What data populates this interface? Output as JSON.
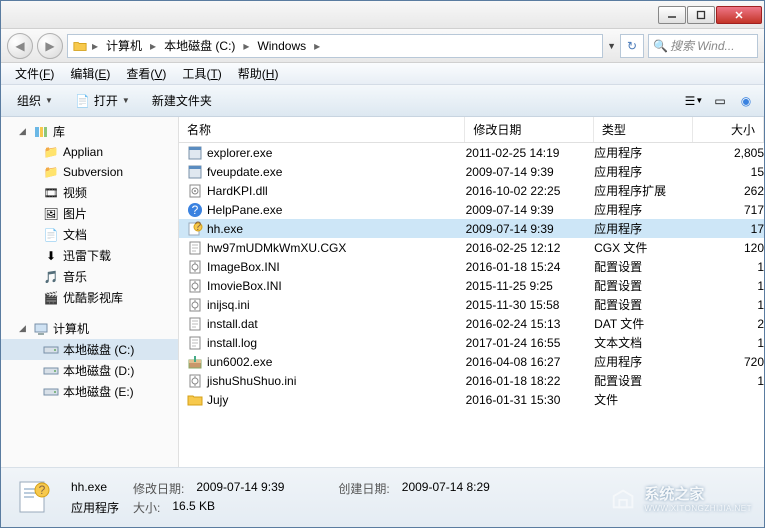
{
  "titlebar": {
    "minimize": "—",
    "maximize": "▢",
    "close": "✕"
  },
  "nav": {
    "breadcrumb": [
      {
        "icon": "computer",
        "label": "计算机"
      },
      {
        "icon": null,
        "label": "本地磁盘 (C:)"
      },
      {
        "icon": null,
        "label": "Windows"
      }
    ],
    "search_placeholder": "搜索 Wind..."
  },
  "menu": [
    {
      "label": "文件",
      "key": "F"
    },
    {
      "label": "编辑",
      "key": "E"
    },
    {
      "label": "查看",
      "key": "V"
    },
    {
      "label": "工具",
      "key": "T"
    },
    {
      "label": "帮助",
      "key": "H"
    }
  ],
  "toolbar": {
    "organize": "组织",
    "open": "打开",
    "newfolder": "新建文件夹"
  },
  "sidebar": {
    "library": "库",
    "library_items": [
      "Applian",
      "Subversion",
      "视频",
      "图片",
      "文档",
      "迅雷下载",
      "音乐",
      "优酷影视库"
    ],
    "computer": "计算机",
    "drives": [
      "本地磁盘 (C:)",
      "本地磁盘 (D:)",
      "本地磁盘 (E:)"
    ]
  },
  "columns": {
    "name": "名称",
    "date": "修改日期",
    "type": "类型",
    "size": "大小"
  },
  "files": [
    {
      "icon": "app",
      "name": "explorer.exe",
      "date": "2011-02-25 14:19",
      "type": "应用程序",
      "size": "2,805",
      "sel": false
    },
    {
      "icon": "app",
      "name": "fveupdate.exe",
      "date": "2009-07-14 9:39",
      "type": "应用程序",
      "size": "15",
      "sel": false
    },
    {
      "icon": "dll",
      "name": "HardKPI.dll",
      "date": "2016-10-02 22:25",
      "type": "应用程序扩展",
      "size": "262",
      "sel": false
    },
    {
      "icon": "helpexe",
      "name": "HelpPane.exe",
      "date": "2009-07-14 9:39",
      "type": "应用程序",
      "size": "717",
      "sel": false
    },
    {
      "icon": "hh",
      "name": "hh.exe",
      "date": "2009-07-14 9:39",
      "type": "应用程序",
      "size": "17",
      "sel": true
    },
    {
      "icon": "txt",
      "name": "hw97mUDMkWmXU.CGX",
      "date": "2016-02-25 12:12",
      "type": "CGX 文件",
      "size": "120",
      "sel": false
    },
    {
      "icon": "ini",
      "name": "ImageBox.INI",
      "date": "2016-01-18 15:24",
      "type": "配置设置",
      "size": "1",
      "sel": false
    },
    {
      "icon": "ini",
      "name": "ImovieBox.INI",
      "date": "2015-11-25 9:25",
      "type": "配置设置",
      "size": "1",
      "sel": false
    },
    {
      "icon": "ini",
      "name": "inijsq.ini",
      "date": "2015-11-30 15:58",
      "type": "配置设置",
      "size": "1",
      "sel": false
    },
    {
      "icon": "txt",
      "name": "install.dat",
      "date": "2016-02-24 15:13",
      "type": "DAT 文件",
      "size": "2",
      "sel": false
    },
    {
      "icon": "txt",
      "name": "install.log",
      "date": "2017-01-24 16:55",
      "type": "文本文档",
      "size": "1",
      "sel": false
    },
    {
      "icon": "inst",
      "name": "iun6002.exe",
      "date": "2016-04-08 16:27",
      "type": "应用程序",
      "size": "720",
      "sel": false
    },
    {
      "icon": "ini",
      "name": "jishuShuShuo.ini",
      "date": "2016-01-18 18:22",
      "type": "配置设置",
      "size": "1",
      "sel": false
    },
    {
      "icon": "folder",
      "name": "Jujy",
      "date": "2016-01-31 15:30",
      "type": "文件",
      "size": "",
      "sel": false
    }
  ],
  "status": {
    "filename": "hh.exe",
    "type": "应用程序",
    "date_label": "修改日期:",
    "date": "2009-07-14 9:39",
    "size_label": "大小:",
    "size": "16.5 KB",
    "created_label": "创建日期:",
    "created": "2009-07-14 8:29"
  },
  "watermark": {
    "text1": "系统之家",
    "text2": "WWW.XITONGZHIJIA.NET"
  }
}
